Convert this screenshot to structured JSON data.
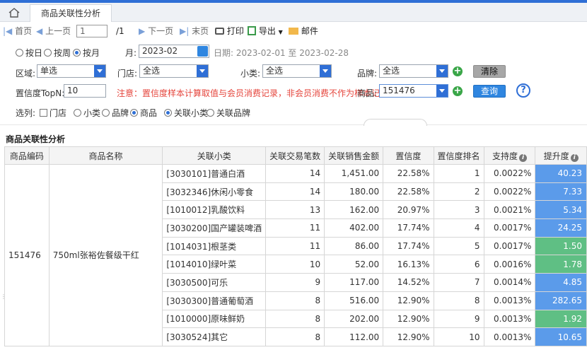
{
  "tabbar": {
    "tab_label": "商品关联性分析"
  },
  "toolbar": {
    "first": "首页",
    "prev": "上一页",
    "page_value": "1",
    "page_total": "/1",
    "next": "下一页",
    "last": "末页",
    "print": "打印",
    "export": "导出",
    "mail": "邮件"
  },
  "filters": {
    "period_day": "按日",
    "period_week": "按周",
    "period_month": "按月",
    "month_label": "月:",
    "month_value": "2023-02",
    "date_range": "日期: 2023-02-01 至 2023-02-28",
    "region_label": "区域:",
    "region_value": "单选",
    "store_label": "门店:",
    "store_value": "全选",
    "category_label": "小类:",
    "category_value": "全选",
    "brand_label": "品牌:",
    "brand_value": "全选",
    "clear_button": "清除",
    "topn_label": "置信度TopN:",
    "topn_value": "10",
    "notice": "注意：置信度样本计算取值与会员消费记录，非会员消费不作为样本记",
    "product_label": "商品:",
    "product_value": "151476",
    "query_button": "查询",
    "help": "?",
    "columns_label": "选列:",
    "col_store": "门店",
    "col_category": "小类",
    "col_brand": "品牌",
    "col_product": "商品",
    "col_assoc_category": "关联小类",
    "col_assoc_brand": "关联品牌"
  },
  "section_title": "商品关联性分析",
  "table": {
    "headers": [
      "商品编码",
      "商品名称",
      "关联小类",
      "关联交易笔数",
      "关联销售金额",
      "置信度",
      "置信度排名",
      "支持度",
      "提升度"
    ],
    "product_code": "151476",
    "product_name": "750ml张裕佐餐级干红",
    "rows": [
      {
        "category": "[3030101]普通白酒",
        "count": "14",
        "amount": "1,451.00",
        "confidence": "22.58%",
        "rank": "1",
        "support": "0.0022%",
        "lift": "40.23",
        "lift_color": "#5b9bea",
        "lift_value": 40.23
      },
      {
        "category": "[3032346]休闲小零食",
        "count": "14",
        "amount": "180.00",
        "confidence": "22.58%",
        "rank": "2",
        "support": "0.0022%",
        "lift": "7.33",
        "lift_color": "#5b9bea",
        "lift_value": 7.33
      },
      {
        "category": "[1010012]乳酸饮料",
        "count": "13",
        "amount": "162.00",
        "confidence": "20.97%",
        "rank": "3",
        "support": "0.0021%",
        "lift": "5.34",
        "lift_color": "#5b9bea",
        "lift_value": 5.34
      },
      {
        "category": "[3030200]国产罐装啤酒",
        "count": "11",
        "amount": "402.00",
        "confidence": "17.74%",
        "rank": "4",
        "support": "0.0017%",
        "lift": "24.25",
        "lift_color": "#5b9bea",
        "lift_value": 24.25
      },
      {
        "category": "[1014031]根茎类",
        "count": "11",
        "amount": "86.00",
        "confidence": "17.74%",
        "rank": "5",
        "support": "0.0017%",
        "lift": "1.50",
        "lift_color": "#5fbf84",
        "lift_value": 1.5
      },
      {
        "category": "[1014010]绿叶菜",
        "count": "10",
        "amount": "52.00",
        "confidence": "16.13%",
        "rank": "6",
        "support": "0.0016%",
        "lift": "1.78",
        "lift_color": "#5fbf84",
        "lift_value": 1.78
      },
      {
        "category": "[3030500]可乐",
        "count": "9",
        "amount": "117.00",
        "confidence": "14.52%",
        "rank": "7",
        "support": "0.0014%",
        "lift": "4.85",
        "lift_color": "#5b9bea",
        "lift_value": 4.85
      },
      {
        "category": "[3030300]普通葡萄酒",
        "count": "8",
        "amount": "516.00",
        "confidence": "12.90%",
        "rank": "8",
        "support": "0.0013%",
        "lift": "282.65",
        "lift_color": "#5b9bea",
        "lift_value": 282.65
      },
      {
        "category": "[1010000]原味鲜奶",
        "count": "8",
        "amount": "202.00",
        "confidence": "12.90%",
        "rank": "9",
        "support": "0.0013%",
        "lift": "1.92",
        "lift_color": "#5fbf84",
        "lift_value": 1.92
      },
      {
        "category": "[3030524]其它",
        "count": "8",
        "amount": "112.00",
        "confidence": "12.90%",
        "rank": "10",
        "support": "0.0013%",
        "lift": "10.65",
        "lift_color": "#5b9bea",
        "lift_value": 10.65
      }
    ]
  }
}
